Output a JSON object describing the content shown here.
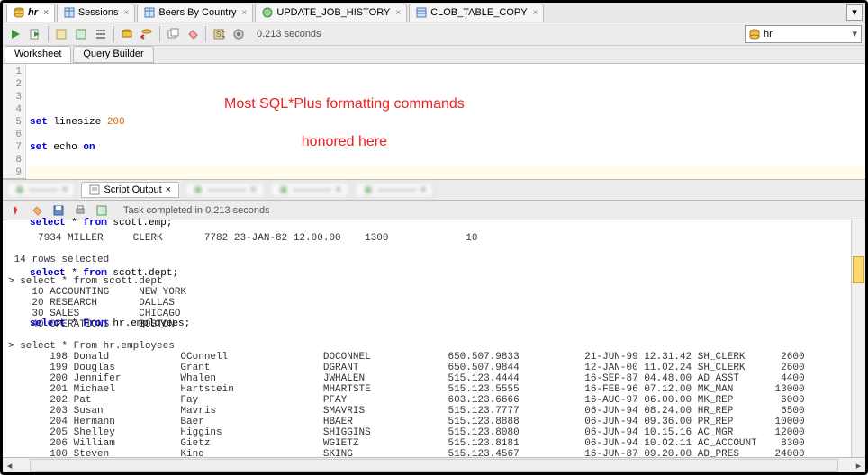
{
  "tabs": [
    {
      "label": "hr",
      "icon": "db",
      "active": true
    },
    {
      "label": "Sessions",
      "icon": "grid"
    },
    {
      "label": "Beers By Country",
      "icon": "grid"
    },
    {
      "label": "UPDATE_JOB_HISTORY",
      "icon": "proc"
    },
    {
      "label": "CLOB_TABLE_COPY",
      "icon": "table"
    }
  ],
  "toolbar_timing": "0.213 seconds",
  "schema": "hr",
  "subtabs": {
    "worksheet": "Worksheet",
    "query_builder": "Query Builder"
  },
  "code_lines": [
    "1",
    "2",
    "3",
    "4",
    "5",
    "6",
    "7",
    "8",
    "9"
  ],
  "code": {
    "l1_a": "set",
    "l1_b": " linesize ",
    "l1_c": "200",
    "l2_a": "set",
    "l2_b": " echo ",
    "l2_c": "on",
    "l5_a": "select",
    "l5_b": " * ",
    "l5_c": "from",
    "l5_d": " scott.emp;",
    "l7_a": "select",
    "l7_b": " * ",
    "l7_c": "from",
    "l7_d": " scott.dept;",
    "l9_a": "select",
    "l9_b": " * ",
    "l9_c": "From",
    "l9_d": " hr.employees;"
  },
  "annotation_line1": "Most SQL*Plus formatting commands",
  "annotation_line2": "honored here",
  "output_tab_label": "Script Output",
  "output_status": "Task completed in 0.213 seconds",
  "output_text": " 7934 MILLER     CLERK       7782 23-JAN-82 12.00.00    1300             10\n\n 14 rows selected\n\n> select * from scott.dept\n    10 ACCOUNTING     NEW YORK\n    20 RESEARCH       DALLAS\n    30 SALES          CHICAGO\n    40 OPERATIONS     BOSTON\n\n> select * From hr.employees\n       198 Donald            OConnell                DOCONNEL             650.507.9833           21-JUN-99 12.31.42 SH_CLERK      2600\n       199 Douglas           Grant                   DGRANT               650.507.9844           12-JAN-00 11.02.24 SH_CLERK      2600\n       200 Jennifer          Whalen                  JWHALEN              515.123.4444           16-SEP-87 04.48.00 AD_ASST       4400\n       201 Michael           Hartstein               MHARTSTE             515.123.5555           16-FEB-96 07.12.00 MK_MAN       13000\n       202 Pat               Fay                     PFAY                 603.123.6666           16-AUG-97 06.00.00 MK_REP        6000\n       203 Susan             Mavris                  SMAVRIS              515.123.7777           06-JUN-94 08.24.00 HR_REP        6500\n       204 Hermann           Baer                    HBAER                515.123.8888           06-JUN-94 09.36.00 PR_REP       10000\n       205 Shelley           Higgins                 SHIGGINS             515.123.8080           06-JUN-94 10.15.16 AC_MGR       12000\n       206 William           Gietz                   WGIETZ               515.123.8181           06-JUN-94 10.02.11 AC_ACCOUNT    8300\n       100 Steven            King                    SKING                515.123.4567           16-JUN-87 09.20.00 AD_PRES      24000"
}
